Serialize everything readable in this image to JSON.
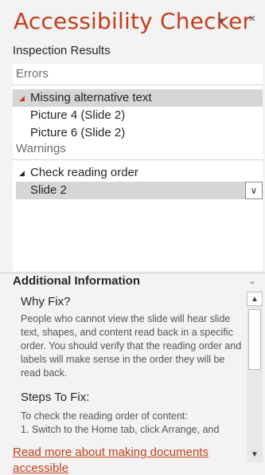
{
  "pane": {
    "title": "Accessibility Checker",
    "menu_glyph": "▾",
    "close_glyph": "×"
  },
  "results": {
    "label": "Inspection Results",
    "errors_header": "Errors",
    "errors": [
      {
        "label": "Missing alternative text",
        "children": [
          "Picture 4  (Slide 2)",
          "Picture 6  (Slide 2)"
        ]
      }
    ],
    "warnings_header": "Warnings",
    "warnings": [
      {
        "label": "Check reading order",
        "children": [
          "Slide 2"
        ]
      }
    ],
    "expand_glyph": "◢",
    "dropdown_glyph": "∨"
  },
  "info": {
    "header": "Additional Information",
    "chevron": "⌄",
    "why_title": "Why Fix?",
    "why_text": "People who cannot view the slide will hear slide text, shapes, and content read back in a specific order. You should verify that the reading order and labels will make sense in the order they will be read back.",
    "steps_title": "Steps To Fix:",
    "steps_line1": "To check the reading order of content:",
    "steps_line2": "1. Switch to the Home tab, click Arrange, and",
    "scroll_up": "▲",
    "scroll_down": "▼",
    "read_more": "Read more about making documents accessible"
  },
  "colors": {
    "accent": "#c43e1c",
    "selection": "#d6d6d6",
    "background": "#f3f3f3"
  }
}
